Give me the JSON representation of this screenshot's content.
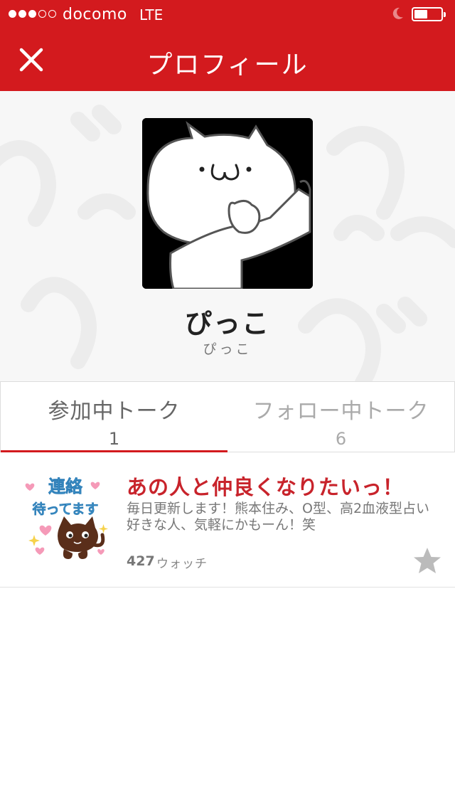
{
  "status_bar": {
    "carrier": "docomo",
    "network": "LTE",
    "signal_strength": 3,
    "battery_level": 0.45
  },
  "nav": {
    "title": "プロフィール",
    "close_icon": "close-icon"
  },
  "profile": {
    "name": "ぴっこ",
    "id": "ぴっこ"
  },
  "tabs": [
    {
      "label": "参加中トーク",
      "count": "1",
      "active": true
    },
    {
      "label": "フォロー中トーク",
      "count": "6",
      "active": false
    }
  ],
  "talks": [
    {
      "title": "あの人と仲良くなりたいっ！",
      "description": "毎日更新します！熊本住み、O型、高2血液型占い好きな人、気軽にかもーん！笑",
      "watch_count": "427",
      "watch_label": "ウォッチ",
      "thumbnail_text": [
        "連絡",
        "待ってます"
      ],
      "starred": false
    }
  ],
  "colors": {
    "brand_red": "#d31a1e",
    "title_red": "#c8232b",
    "text_gray": "#777777",
    "star_gray": "#bbbbbb"
  }
}
